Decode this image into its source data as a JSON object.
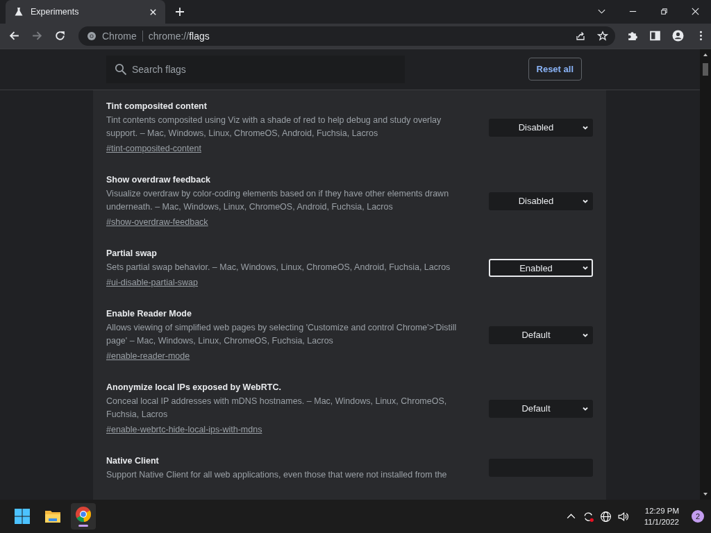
{
  "tab": {
    "title": "Experiments"
  },
  "address": {
    "site": "Chrome",
    "url_prefix": "chrome://",
    "url_path": "flags"
  },
  "search": {
    "placeholder": "Search flags"
  },
  "reset_button": "Reset all",
  "flags": [
    {
      "title": "Tint composited content",
      "description": "Tint contents composited using Viz with a shade of red to help debug and study overlay support. – Mac, Windows, Linux, ChromeOS, Android, Fuchsia, Lacros",
      "link": "#tint-composited-content",
      "value": "Disabled",
      "focused": false
    },
    {
      "title": "Show overdraw feedback",
      "description": "Visualize overdraw by color-coding elements based on if they have other elements drawn underneath. – Mac, Windows, Linux, ChromeOS, Android, Fuchsia, Lacros",
      "link": "#show-overdraw-feedback",
      "value": "Disabled",
      "focused": false
    },
    {
      "title": "Partial swap",
      "description": "Sets partial swap behavior. – Mac, Windows, Linux, ChromeOS, Android, Fuchsia, Lacros",
      "link": "#ui-disable-partial-swap",
      "value": "Enabled",
      "focused": true
    },
    {
      "title": "Enable Reader Mode",
      "description": "Allows viewing of simplified web pages by selecting 'Customize and control Chrome'>'Distill page' – Mac, Windows, Linux, ChromeOS, Fuchsia, Lacros",
      "link": "#enable-reader-mode",
      "value": "Default",
      "focused": false
    },
    {
      "title": "Anonymize local IPs exposed by WebRTC.",
      "description": "Conceal local IP addresses with mDNS hostnames. – Mac, Windows, Linux, ChromeOS, Fuchsia, Lacros",
      "link": "#enable-webrtc-hide-local-ips-with-mdns",
      "value": "Default",
      "focused": false
    },
    {
      "title": "Native Client",
      "description": "Support Native Client for all web applications, even those that were not installed from the",
      "focused": false
    }
  ],
  "taskbar": {
    "time": "12:29 PM",
    "date": "11/1/2022",
    "notification_count": "2"
  }
}
